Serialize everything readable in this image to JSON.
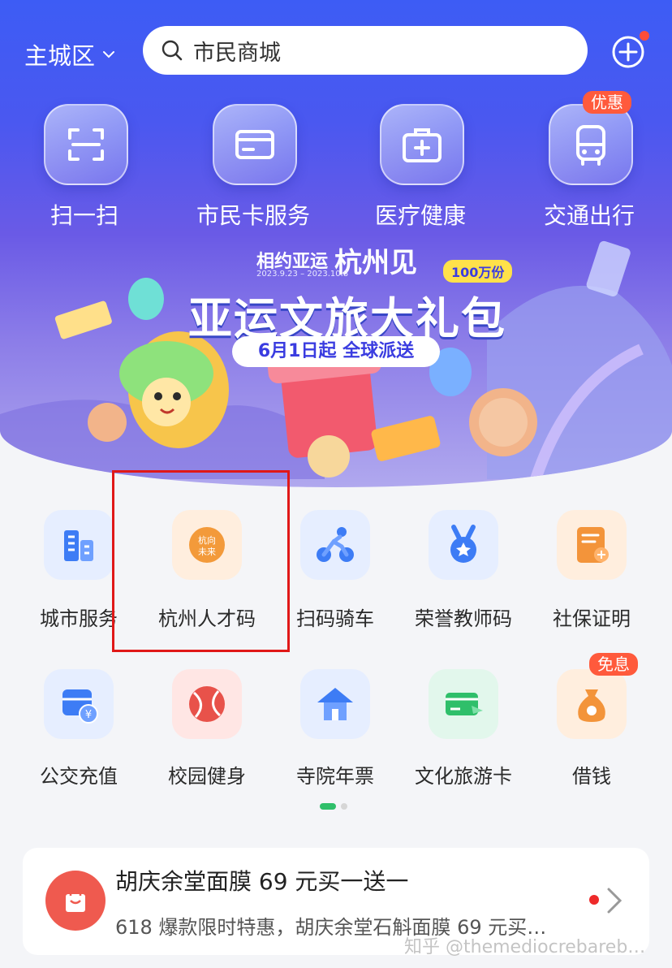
{
  "topbar": {
    "city": "主城区",
    "search_value": "市民商城"
  },
  "quick_actions": [
    {
      "label": "扫一扫",
      "icon": "scan-icon"
    },
    {
      "label": "市民卡服务",
      "icon": "card-icon"
    },
    {
      "label": "医疗健康",
      "icon": "medical-kit-icon"
    },
    {
      "label": "交通出行",
      "icon": "bus-icon",
      "badge": "优惠"
    }
  ],
  "banner": {
    "tagline": "相约亚运",
    "city": "杭州见",
    "dates": "2023.9.23 – 2023.10.8",
    "title": "亚运文旅大礼包",
    "subtitle": "6月1日起 全球派送",
    "tag": "100万份"
  },
  "services_row1": [
    {
      "label": "城市服务",
      "icon": "city-building-icon"
    },
    {
      "label": "杭州人才码",
      "icon": "talent-code-icon"
    },
    {
      "label": "扫码骑车",
      "icon": "bike-icon"
    },
    {
      "label": "荣誉教师码",
      "icon": "medal-icon"
    },
    {
      "label": "社保证明",
      "icon": "document-icon"
    }
  ],
  "services_row2": [
    {
      "label": "公交充值",
      "icon": "bus-card-icon"
    },
    {
      "label": "校园健身",
      "icon": "ball-icon"
    },
    {
      "label": "寺院年票",
      "icon": "temple-icon"
    },
    {
      "label": "文化旅游卡",
      "icon": "travel-card-icon"
    },
    {
      "label": "借钱",
      "icon": "money-bag-icon",
      "badge": "免息"
    }
  ],
  "promo": {
    "title": "胡庆余堂面膜 69 元买一送一",
    "subtitle": "618 爆款限时特惠，胡庆余堂石斛面膜 69 元买…"
  },
  "watermark": "知乎 @themediocrebareb…",
  "colors": {
    "hero_top": "#3d5cf5",
    "highlight": "#e01818",
    "badge": "#ff5a3c",
    "page_indicator": "#2fbf6a"
  }
}
